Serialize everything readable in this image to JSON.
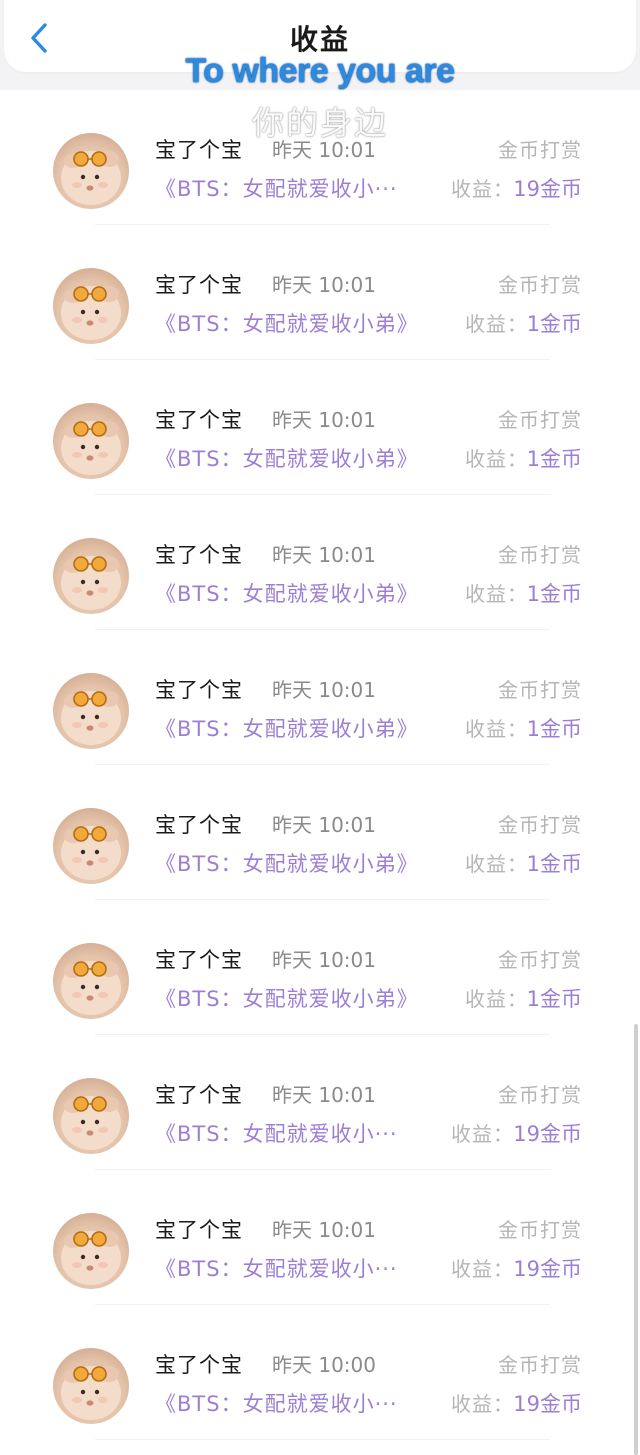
{
  "header": {
    "title": "收益"
  },
  "watermark": {
    "english": "To where you are",
    "chinese": "你的身边"
  },
  "rows": [
    {
      "name": "宝了个宝",
      "time": "昨天 10:01",
      "type": "金币打赏",
      "book": "《BTS：女配就爱收小···",
      "income_label": "收益：",
      "income_value": "19金币"
    },
    {
      "name": "宝了个宝",
      "time": "昨天 10:01",
      "type": "金币打赏",
      "book": "《BTS：女配就爱收小弟》",
      "income_label": "收益：",
      "income_value": "1金币"
    },
    {
      "name": "宝了个宝",
      "time": "昨天 10:01",
      "type": "金币打赏",
      "book": "《BTS：女配就爱收小弟》",
      "income_label": "收益：",
      "income_value": "1金币"
    },
    {
      "name": "宝了个宝",
      "time": "昨天 10:01",
      "type": "金币打赏",
      "book": "《BTS：女配就爱收小弟》",
      "income_label": "收益：",
      "income_value": "1金币"
    },
    {
      "name": "宝了个宝",
      "time": "昨天 10:01",
      "type": "金币打赏",
      "book": "《BTS：女配就爱收小弟》",
      "income_label": "收益：",
      "income_value": "1金币"
    },
    {
      "name": "宝了个宝",
      "time": "昨天 10:01",
      "type": "金币打赏",
      "book": "《BTS：女配就爱收小弟》",
      "income_label": "收益：",
      "income_value": "1金币"
    },
    {
      "name": "宝了个宝",
      "time": "昨天 10:01",
      "type": "金币打赏",
      "book": "《BTS：女配就爱收小弟》",
      "income_label": "收益：",
      "income_value": "1金币"
    },
    {
      "name": "宝了个宝",
      "time": "昨天 10:01",
      "type": "金币打赏",
      "book": "《BTS：女配就爱收小···",
      "income_label": "收益：",
      "income_value": "19金币"
    },
    {
      "name": "宝了个宝",
      "time": "昨天 10:01",
      "type": "金币打赏",
      "book": "《BTS：女配就爱收小···",
      "income_label": "收益：",
      "income_value": "19金币"
    },
    {
      "name": "宝了个宝",
      "time": "昨天 10:00",
      "type": "金币打赏",
      "book": "《BTS：女配就爱收小···",
      "income_label": "收益：",
      "income_value": "19金币"
    }
  ],
  "colors": {
    "accent_blue": "#2a8be0",
    "book_purple": "#9c7fd4",
    "muted_gray": "#b5b5b5"
  }
}
